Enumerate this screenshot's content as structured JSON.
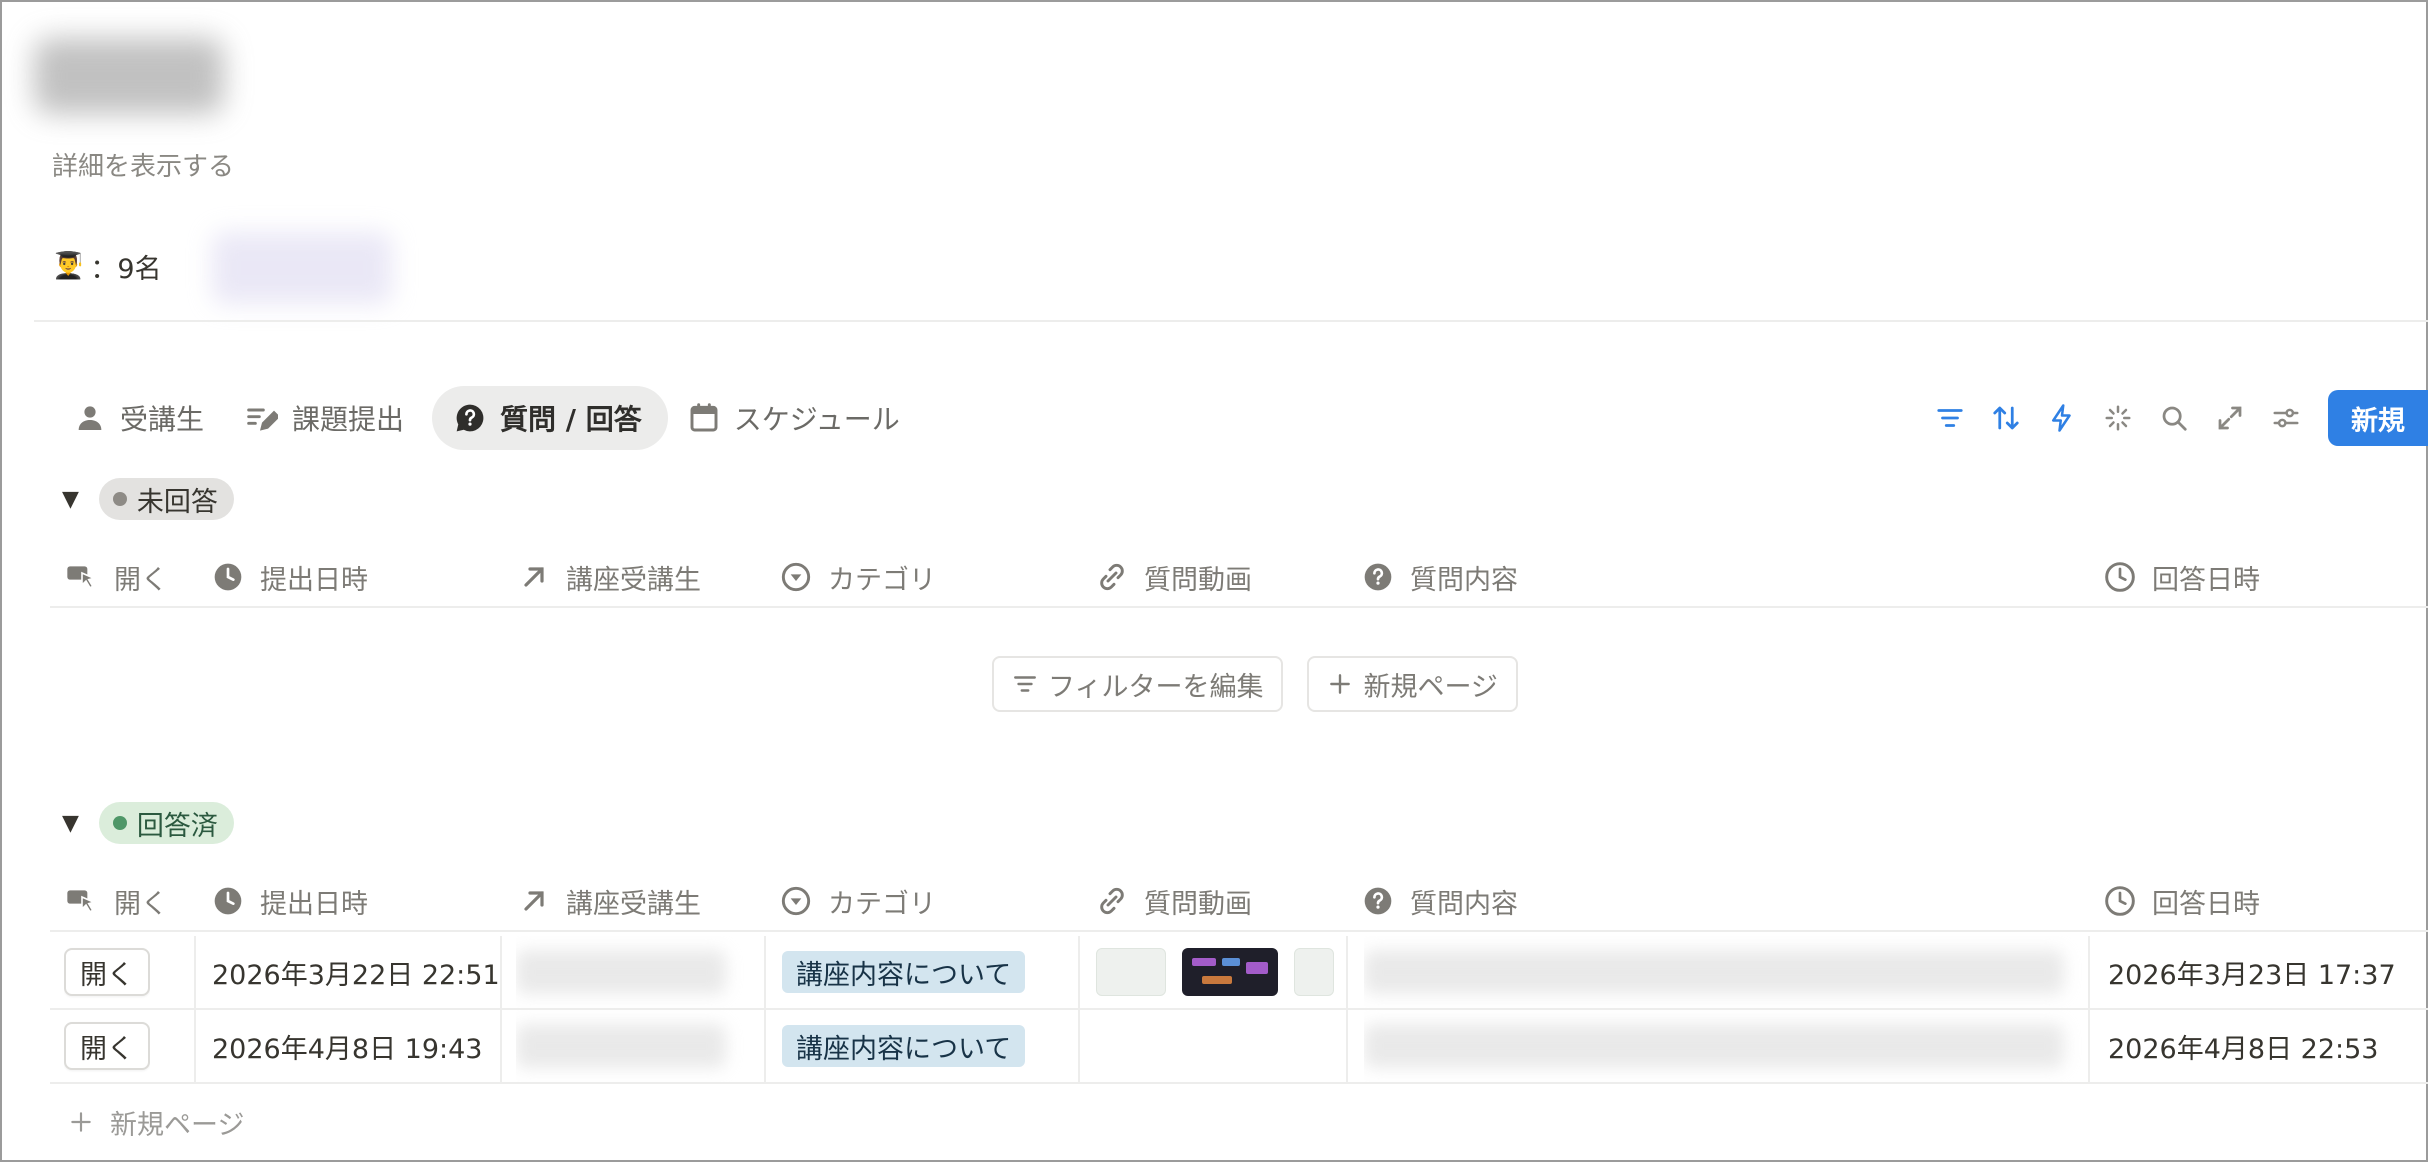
{
  "page": {
    "show_details": "詳細を表示する",
    "meta_emoji": "👨‍🎓",
    "meta_text": "：9名"
  },
  "tabs": [
    {
      "label": "受講生",
      "icon": "person-icon"
    },
    {
      "label": "課題提出",
      "icon": "edit-list-icon"
    },
    {
      "label": "質問 / 回答",
      "icon": "question-bubble-icon",
      "active": true
    },
    {
      "label": "スケジュール",
      "icon": "calendar-icon"
    }
  ],
  "toolbar": {
    "icons": [
      "filter-icon",
      "sort-icon",
      "automation-bolt-icon",
      "ai-sparkle-icon",
      "search-icon",
      "expand-icon",
      "settings-sliders-icon"
    ],
    "new_label": "新規"
  },
  "columns": [
    {
      "label": "開く",
      "icon": "open-cursor-icon"
    },
    {
      "label": "提出日時",
      "icon": "clock-icon"
    },
    {
      "label": "講座受講生",
      "icon": "relation-arrow-icon"
    },
    {
      "label": "カテゴリ",
      "icon": "select-icon"
    },
    {
      "label": "質問動画",
      "icon": "attachment-icon"
    },
    {
      "label": "質問内容",
      "icon": "help-circle-icon"
    },
    {
      "label": "回答日時",
      "icon": "clock-icon"
    }
  ],
  "groups": {
    "unanswered": {
      "label": "未回答",
      "empty_actions": {
        "edit_filter": "フィルターを編集",
        "new_page": "新規ページ"
      }
    },
    "answered": {
      "label": "回答済",
      "rows": [
        {
          "open": "開く",
          "submitted": "2026年3月22日 22:51",
          "category": "講座内容について",
          "answered": "2026年3月23日 17:37"
        },
        {
          "open": "開く",
          "submitted": "2026年4月8日 19:43",
          "category": "講座内容について",
          "answered": "2026年4月8日 22:53"
        }
      ]
    }
  },
  "footer": {
    "new_page": "新規ページ"
  },
  "colors": {
    "accent": "#2f80e4",
    "tag_blue_bg": "#d3e5ef",
    "status_green": "#4f9768",
    "status_gray": "#8e8b86"
  }
}
